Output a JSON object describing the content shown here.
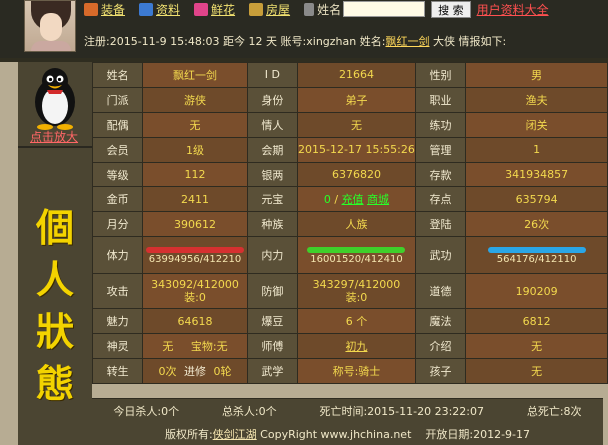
{
  "nav": {
    "items": [
      {
        "key": "equip",
        "label": "装备",
        "color": "#d76a2a"
      },
      {
        "key": "profile",
        "label": "资料",
        "color": "#3c7ad2"
      },
      {
        "key": "flower",
        "label": "鲜花",
        "color": "#e0448a"
      },
      {
        "key": "house",
        "label": "房屋",
        "color": "#c89e3a"
      }
    ],
    "name_label": "姓名",
    "search_value": "",
    "search_button": "搜 索",
    "all_profiles": "用户资料大全"
  },
  "info": {
    "reg_label": "注册:",
    "reg_date": "2015-11-9 15:48:03",
    "age_prefix": "距今",
    "age_days": "12",
    "age_suffix": "天",
    "account_label": "账号:",
    "account": "xingzhan",
    "name_label": "姓名:",
    "name": "飘红一剑",
    "title": "大侠",
    "report": "情报如下:"
  },
  "left": {
    "zoom_label": "点击放大",
    "vertical_title": [
      "個",
      "人",
      "狀",
      "態"
    ]
  },
  "grid": {
    "r1": {
      "l1": "姓名",
      "v1": "飘红一剑",
      "l2": "I D",
      "v2": "21664",
      "l3": "性别",
      "v3": "男"
    },
    "r2": {
      "l1": "门派",
      "v1": "游侠",
      "l2": "身份",
      "v2": "弟子",
      "l3": "职业",
      "v3": "渔夫"
    },
    "r3": {
      "l1": "配偶",
      "v1": "无",
      "l2": "情人",
      "v2": "无",
      "l3": "练功",
      "v3": "闭关"
    },
    "r4": {
      "l1": "会员",
      "v1": "1级",
      "l2": "会期",
      "v2": "2015-12-17 15:55:26",
      "l3": "管理",
      "v3": "1"
    },
    "r5": {
      "l1": "等级",
      "v1": "112",
      "l2": "银两",
      "v2": "6376820",
      "l3": "存款",
      "v3": "341934857"
    },
    "r6": {
      "l1": "金币",
      "v1": "2411",
      "l2": "元宝",
      "v2a": "0",
      "v2sep": "/",
      "v2b": "充值",
      "v2c": "商城",
      "l3": "存点",
      "v3": "635794"
    },
    "r7": {
      "l1": "月分",
      "v1": "390612",
      "l2": "种族",
      "v2": "人族",
      "l3": "登陆",
      "v3": "26次"
    },
    "r8": {
      "l1": "体力",
      "v1": "63994956/412210",
      "l2": "内力",
      "v2": "16001520/412410",
      "l3": "武功",
      "v3": "564176/412110",
      "bars": {
        "hp": {
          "fill": 1,
          "color": "#d63030"
        },
        "mp": {
          "fill": 1,
          "color": "#3fcf2a"
        },
        "sk": {
          "fill": 1,
          "color": "#2aa6e6"
        }
      }
    },
    "r9": {
      "l1": "攻击",
      "v1a": "343092/412000",
      "v1b": "装:0",
      "l2": "防御",
      "v2a": "343297/412000",
      "v2b": "装:0",
      "l3": "道德",
      "v3": "190209"
    },
    "r10": {
      "l1": "魅力",
      "v1": "64618",
      "l2": "爆豆",
      "v2": "6 个",
      "l3": "魔法",
      "v3": "6812"
    },
    "r11": {
      "l1": "神灵",
      "v1a": "无",
      "v1b": "宝物:无",
      "l2": "师傅",
      "v2": "初九",
      "l3": "介绍",
      "v3": "无"
    },
    "r12": {
      "l1": "转生",
      "v1a": "0次",
      "v1bl": "进修",
      "v1b": "0轮",
      "l2": "武学",
      "v2": "称号:骑士",
      "l3": "孩子",
      "v3": "无"
    }
  },
  "stats": {
    "today_kills": "今日杀人:0个",
    "total_kills": "总杀人:0个",
    "death_time": "死亡时间:2015-11-20 23:22:07",
    "total_deaths": "总死亡:8次"
  },
  "footer": {
    "copyright_label": "版权所有:",
    "site_name": "侠剑江湖",
    "copyright_url": "CopyRight www.jhchina.net",
    "open_date": "开放日期:2012-9-17"
  }
}
